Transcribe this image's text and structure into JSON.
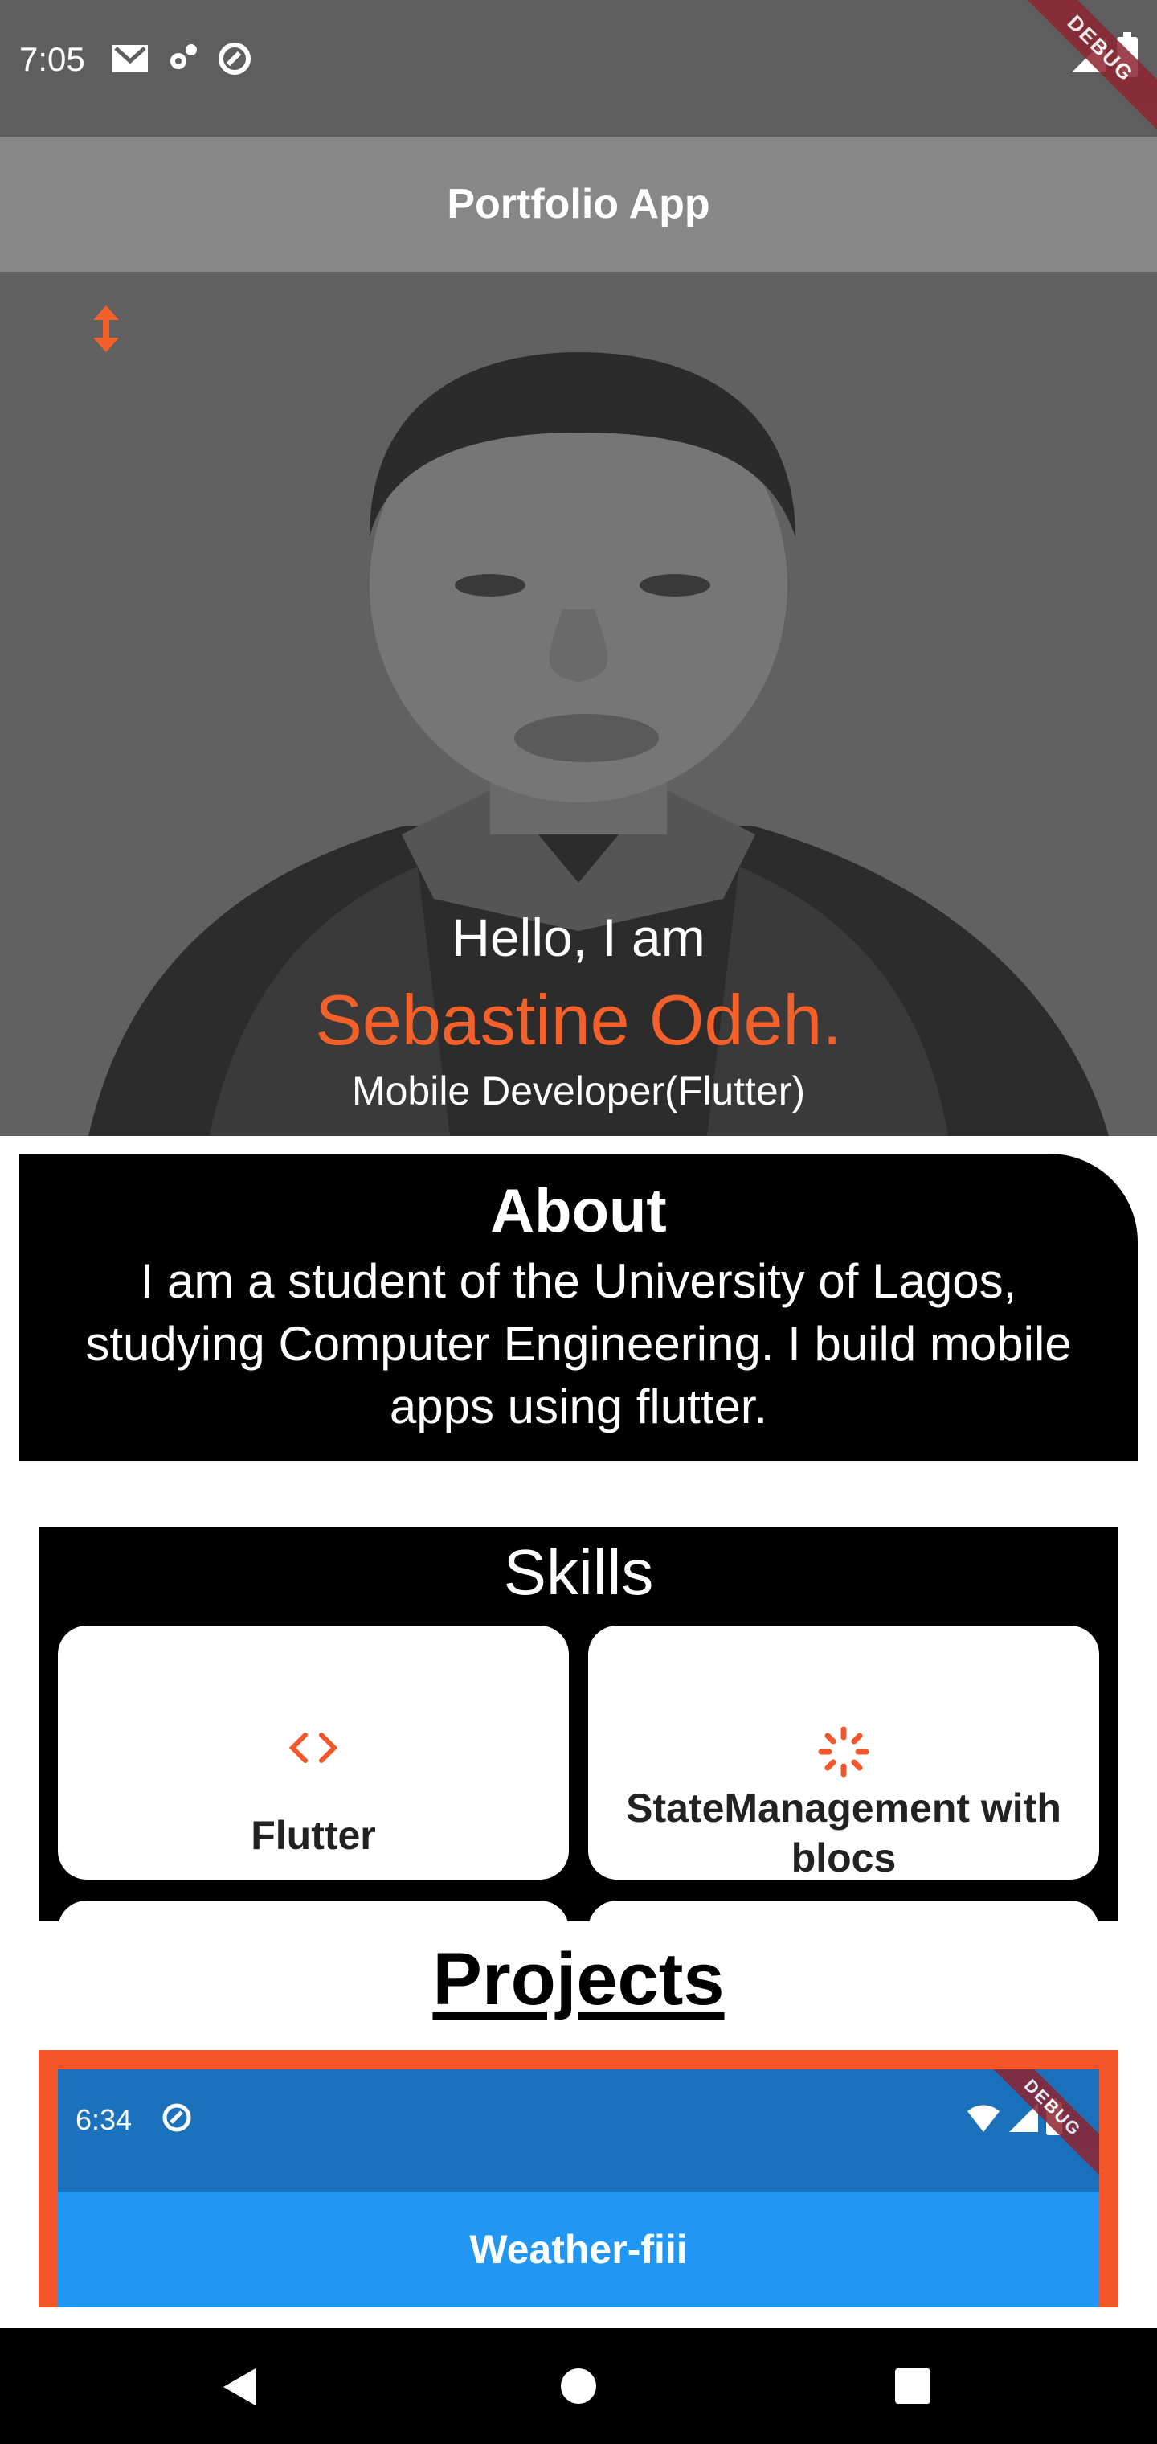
{
  "status_bar": {
    "time": "7:05",
    "debug_label": "DEBUG"
  },
  "app_bar": {
    "title": "Portfolio App"
  },
  "hero": {
    "greeting": "Hello, I am",
    "name": "Sebastine Odeh.",
    "role": "Mobile Developer(Flutter)"
  },
  "about": {
    "title": "About",
    "text": "I am a student of the University of Lagos, studying Computer Engineering. I build mobile apps using flutter."
  },
  "skills": {
    "title": "Skills",
    "items": [
      {
        "label": "Flutter",
        "icon": "code-icon"
      },
      {
        "label": "StateManagement with blocs",
        "icon": "loading-spinner-icon"
      }
    ]
  },
  "projects": {
    "title": "Projects",
    "items": [
      {
        "status_time": "6:34",
        "debug_label": "DEBUG",
        "title": "Weather-fiii"
      }
    ]
  },
  "colors": {
    "accent": "#f4602a",
    "status_bar": "#5e5e5e",
    "app_bar": "#878787",
    "project_blue": "#2196f3"
  }
}
